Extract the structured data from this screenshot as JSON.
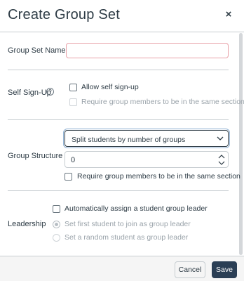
{
  "dialog": {
    "title": "Create Group Set",
    "close_symbol": "×"
  },
  "group_set_name": {
    "label": "Group Set Name",
    "value": ""
  },
  "self_signup": {
    "label": "Self Sign-Up",
    "help_symbol": "?",
    "allow_label": "Allow self sign-up",
    "allow_checked": false,
    "require_section_label": "Require group members to be in the same section",
    "require_section_checked": false
  },
  "group_structure": {
    "label": "Group Structure",
    "selected_option": "Split students by number of groups",
    "number_value": "0",
    "require_section_label": "Require group members to be in the same section",
    "require_section_checked": false
  },
  "leadership": {
    "label": "Leadership",
    "auto_assign_label": "Automatically assign a student group leader",
    "auto_assign_checked": false,
    "options": [
      {
        "label": "Set first student to join as group leader",
        "selected": true
      },
      {
        "label": "Set a random student as group leader",
        "selected": false
      }
    ]
  },
  "footer": {
    "cancel_label": "Cancel",
    "save_label": "Save"
  },
  "colors": {
    "primary_button": "#2b3f55",
    "text": "#2d3b45",
    "border": "#c7cdd1",
    "invalid_border": "#e8a1a8"
  },
  "icons": {
    "close": "close-icon",
    "help": "help-icon",
    "chevron": "chevron-down-icon",
    "stepper_up": "chevron-up-icon",
    "stepper_down": "chevron-down-icon"
  }
}
